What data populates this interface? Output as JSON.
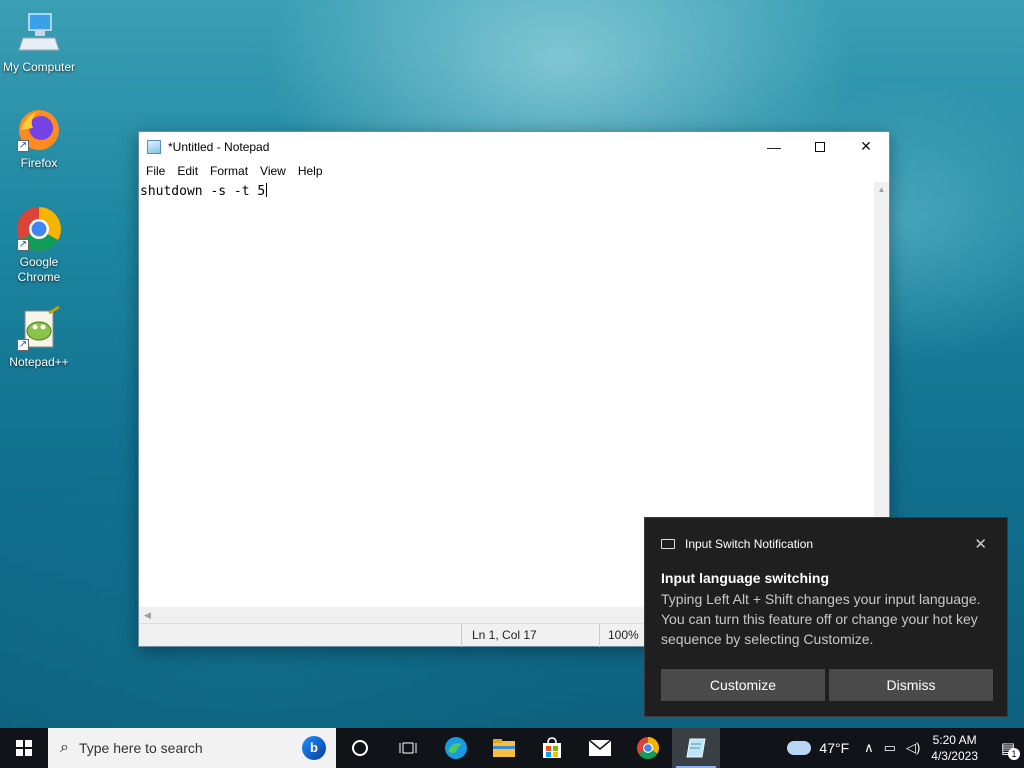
{
  "desktop": {
    "icons": [
      {
        "label": "My Computer"
      },
      {
        "label": "Firefox"
      },
      {
        "label": "Google Chrome"
      },
      {
        "label": "Notepad++"
      }
    ]
  },
  "notepad": {
    "title": "*Untitled - Notepad",
    "menu": [
      "File",
      "Edit",
      "Format",
      "View",
      "Help"
    ],
    "content": "shutdown -s -t 5",
    "status": {
      "position": "Ln 1, Col 17",
      "zoom": "100%"
    }
  },
  "toast": {
    "app_name": "Input Switch Notification",
    "title": "Input language switching",
    "body": "Typing Left Alt + Shift changes your input language. You can turn this feature off or change your hot key sequence by selecting Customize.",
    "customize_label": "Customize",
    "dismiss_label": "Dismiss"
  },
  "taskbar": {
    "search_placeholder": "Type here to search",
    "weather": "47°F",
    "time": "5:20 AM",
    "date": "4/3/2023",
    "notification_count": "1",
    "pinned_icons": [
      "cortana-icon",
      "task-view-icon",
      "edge-icon",
      "file-explorer-icon",
      "microsoft-store-icon",
      "mail-icon",
      "chrome-icon",
      "notepad-icon"
    ]
  },
  "colors": {
    "taskbar": "#101318",
    "toast_bg": "#1f1f1f",
    "toast_button": "#4a4a4a"
  }
}
